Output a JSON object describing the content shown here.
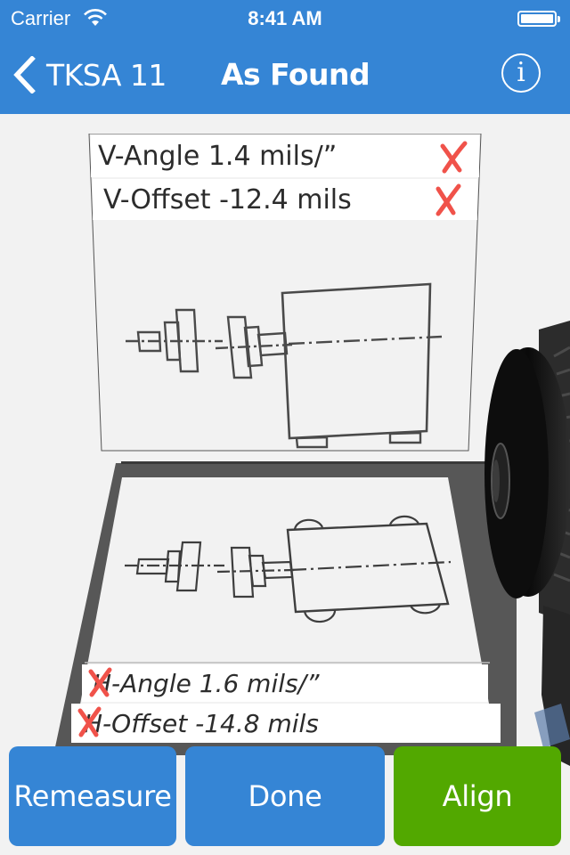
{
  "status_bar": {
    "carrier": "Carrier",
    "time": "8:41 AM",
    "battery_level": 1.0
  },
  "nav": {
    "back_label": "TKSA 11",
    "title": "As Found",
    "info_icon_glyph": "i"
  },
  "vertical": {
    "rows": [
      {
        "label": "V-Angle 1.4 mils/”",
        "status": "out-of-tolerance",
        "status_glyph": "✗"
      },
      {
        "label": "V-Offset -12.4 mils",
        "status": "out-of-tolerance",
        "status_glyph": "✗"
      }
    ],
    "diagram": "vertical-side-view"
  },
  "horizontal": {
    "rows": [
      {
        "label": "H-Angle 1.6 mils/”",
        "status": "out-of-tolerance",
        "status_glyph": "✗"
      },
      {
        "label": "H-Offset -14.8 mils",
        "status": "out-of-tolerance",
        "status_glyph": "✗"
      }
    ],
    "diagram": "horizontal-top-view"
  },
  "buttons": {
    "remeasure": "Remeasure",
    "done": "Done",
    "align": "Align"
  },
  "colors": {
    "brand_blue": "#3585d5",
    "align_green": "#52a800",
    "fail_red": "#f0524a"
  }
}
